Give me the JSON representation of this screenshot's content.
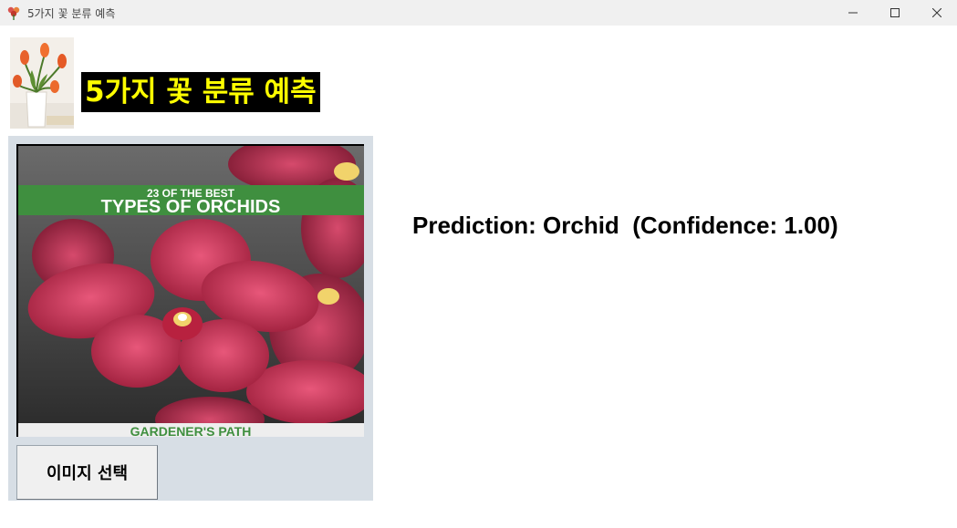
{
  "window": {
    "title": "5가지 꽃 분류 예측",
    "icon": "flower-app-icon",
    "controls": [
      "minimize-icon",
      "maximize-icon",
      "close-icon"
    ]
  },
  "header": {
    "logo": "tulip-vase-image",
    "title": "5가지 꽃 분류 예측",
    "title_color": "#ffff00",
    "title_bg": "#000000"
  },
  "preview": {
    "banner_top": "23 OF THE BEST",
    "banner_main": "TYPES OF ORCHIDS",
    "footer": "GARDENER'S PATH",
    "banner_color": "#3f8f3f"
  },
  "controls": {
    "select_image_label": "이미지 선택"
  },
  "result": {
    "prediction_text": "Prediction: Orchid  (Confidence: 1.00)"
  },
  "colors": {
    "panel_bg": "#d7dee5",
    "titlebar_bg": "#f0f0f0"
  }
}
